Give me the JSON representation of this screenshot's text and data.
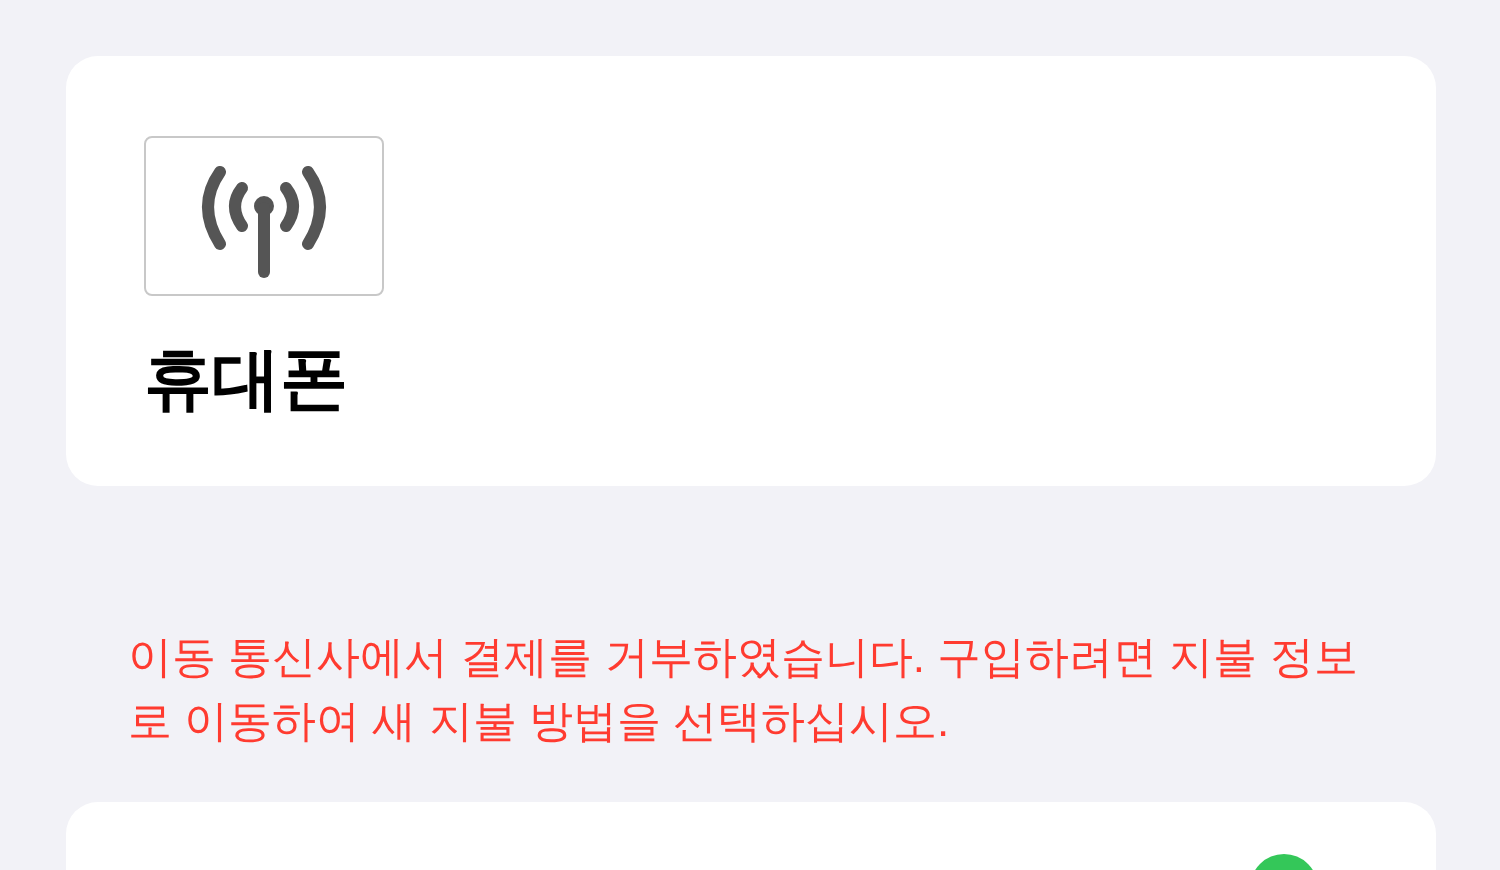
{
  "device_card": {
    "title": "휴대폰"
  },
  "error_message": "이동 통신사에서 결제를 거부하였습니다. 구입하려면 지불 정보로 이동하여 새 지불 방법을 선택하십시오."
}
